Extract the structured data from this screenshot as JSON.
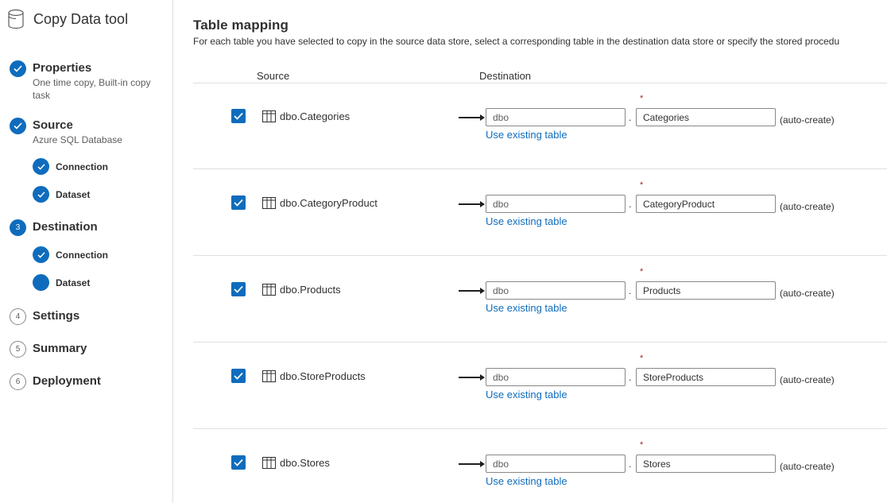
{
  "app": {
    "title": "Copy Data tool",
    "icon": "database-icon"
  },
  "steps": [
    {
      "number": "1",
      "title": "Properties",
      "description": "One time copy, Built-in copy task",
      "status": "done"
    },
    {
      "number": "2",
      "title": "Source",
      "description": "Azure SQL Database",
      "status": "done",
      "substeps": [
        {
          "label": "Connection",
          "status": "done"
        },
        {
          "label": "Dataset",
          "status": "done"
        }
      ]
    },
    {
      "number": "3",
      "title": "Destination",
      "description": "",
      "status": "current",
      "substeps": [
        {
          "label": "Connection",
          "status": "done"
        },
        {
          "label": "Dataset",
          "status": "current"
        }
      ]
    },
    {
      "number": "4",
      "title": "Settings",
      "status": "todo"
    },
    {
      "number": "5",
      "title": "Summary",
      "status": "todo"
    },
    {
      "number": "6",
      "title": "Deployment",
      "status": "todo"
    }
  ],
  "main": {
    "title": "Table mapping",
    "description": "For each table you have selected to copy in the source data store, select a corresponding table in the destination data store or specify the stored procedu",
    "columns": {
      "source": "Source",
      "destination": "Destination"
    },
    "required_marker": "*",
    "dot": ".",
    "auto_create": "(auto-create)",
    "use_existing": "Use existing table",
    "rows": [
      {
        "checked": true,
        "source": "dbo.Categories",
        "schema": "dbo",
        "table": "Categories"
      },
      {
        "checked": true,
        "source": "dbo.CategoryProduct",
        "schema": "dbo",
        "table": "CategoryProduct"
      },
      {
        "checked": true,
        "source": "dbo.Products",
        "schema": "dbo",
        "table": "Products"
      },
      {
        "checked": true,
        "source": "dbo.StoreProducts",
        "schema": "dbo",
        "table": "StoreProducts"
      },
      {
        "checked": true,
        "source": "dbo.Stores",
        "schema": "dbo",
        "table": "Stores"
      }
    ]
  },
  "colors": {
    "accent": "#0f6cbd",
    "required": "#a4262c",
    "border": "#e1dfdd"
  }
}
